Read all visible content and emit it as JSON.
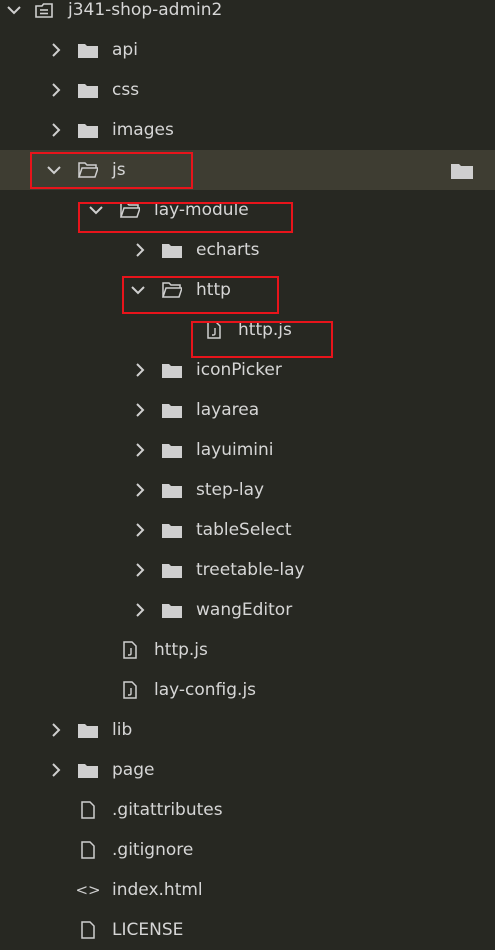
{
  "project": {
    "name": "j341-shop-admin2"
  },
  "tree": {
    "api": "api",
    "css": "css",
    "images": "images",
    "js": "js",
    "lay_module": "lay-module",
    "echarts": "echarts",
    "http": "http",
    "http_js_inner": "http.js",
    "iconPicker": "iconPicker",
    "layarea": "layarea",
    "layuimini": "layuimini",
    "step_lay": "step-lay",
    "tableSelect": "tableSelect",
    "treetable_lay": "treetable-lay",
    "wangEditor": "wangEditor",
    "http_js": "http.js",
    "lay_config_js": "lay-config.js",
    "lib": "lib",
    "page": "page",
    "gitattributes": ".gitattributes",
    "gitignore": ".gitignore",
    "index_html": "index.html",
    "license": "LICENSE"
  },
  "icon_glyphs": {
    "html_icon": "<>"
  },
  "colors": {
    "background": "#272822",
    "selected_row": "#3e3d32",
    "highlight_box": "#e8141b",
    "text": "#d6d6d6",
    "icon": "#cfcfcf"
  }
}
